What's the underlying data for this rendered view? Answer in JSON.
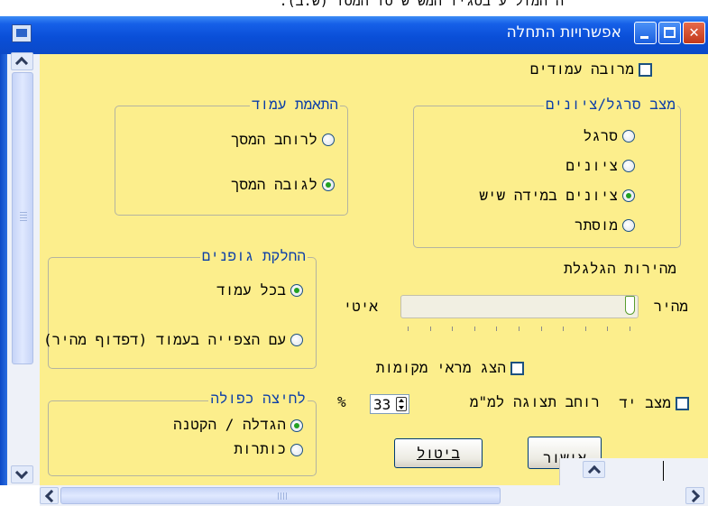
{
  "top_clipped_text": "ה המול ע בסגיו המש ש סו המסו (ש.ב).",
  "window": {
    "title": "אפשרויות התחלה",
    "close_glyph": "✕"
  },
  "options": {
    "multi_columns_label": "מרובה עמודים",
    "multi_columns_checked": false
  },
  "ruler_group": {
    "legend": "מצב סרגל/ציונים",
    "options": [
      {
        "label": "סרגל",
        "selected": false
      },
      {
        "label": "ציונים",
        "selected": false
      },
      {
        "label": "ציונים במידה שיש",
        "selected": true
      },
      {
        "label": "מוסתר",
        "selected": false
      }
    ]
  },
  "column_fit_group": {
    "legend": "התאמת עמוד",
    "options": [
      {
        "label": "לרוחב המסך",
        "selected": false
      },
      {
        "label": "לגובה המסך",
        "selected": true
      }
    ]
  },
  "font_group": {
    "legend": "החלקת גופנים",
    "options": [
      {
        "label": "בכל עמוד",
        "selected": true
      },
      {
        "label": "עם הצפייה בעמוד (דפדוף מהיר)",
        "selected": false
      }
    ]
  },
  "scroll_speed": {
    "label": "מהירות הגלגלת",
    "fast_label": "מהיר",
    "slow_label": "איטי",
    "value_fraction": 1.0
  },
  "show_local_refs": {
    "label": "הצג מראי מקומות",
    "checked": false
  },
  "display_width": {
    "label": "רוחב תצוגה למ\"מ",
    "value": "33",
    "unit": "%"
  },
  "hand_mode": {
    "label": "מצב יד",
    "checked": false
  },
  "double_click_group": {
    "legend": "לחיצה כפולה",
    "options": [
      {
        "label": "הגדלה / הקטנה",
        "selected": true
      },
      {
        "label": "כותרות",
        "selected": false
      }
    ]
  },
  "buttons": {
    "ok": "אישור",
    "cancel": "ביטול"
  },
  "colors": {
    "panel_bg": "#fcee8c",
    "titlebar": "#0b49c7",
    "legend_text": "#0b3ea8"
  }
}
